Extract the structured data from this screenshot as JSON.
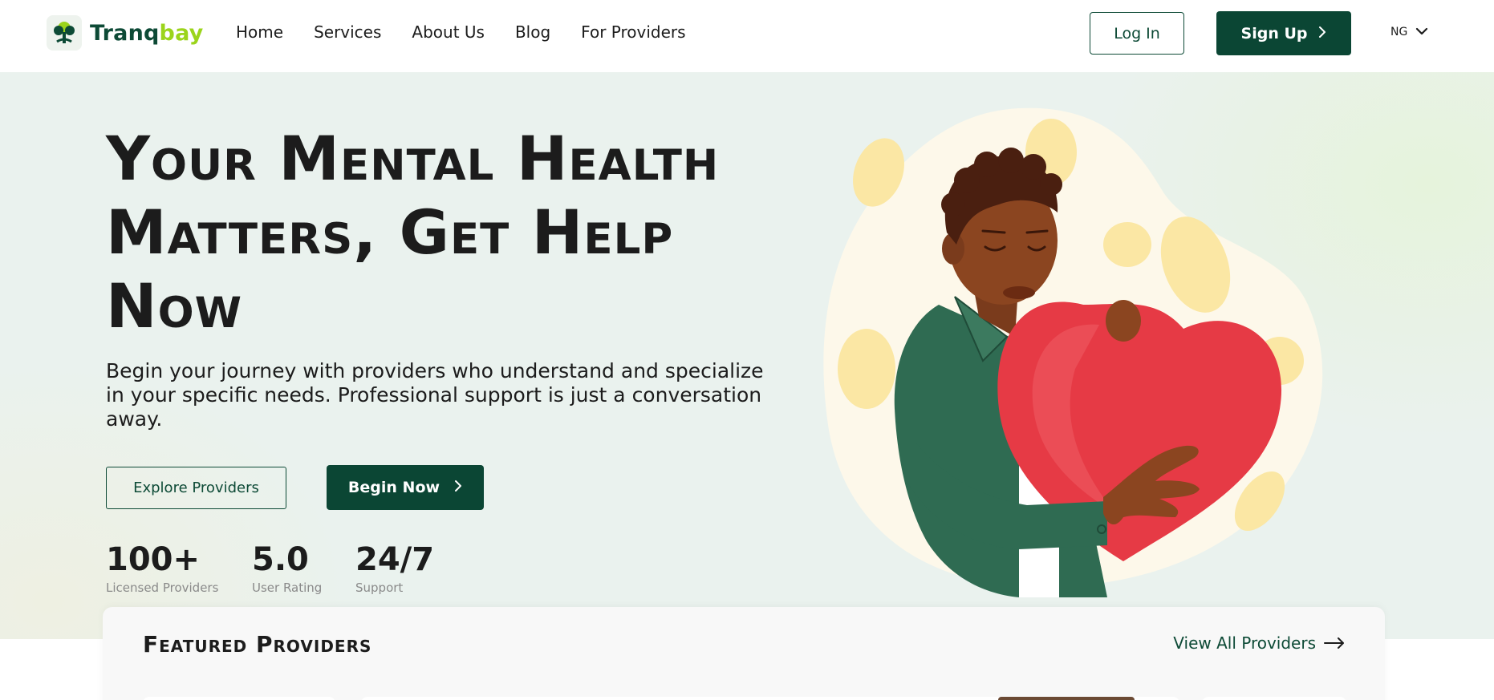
{
  "header": {
    "logo_part1": "Tranq",
    "logo_part2": "bay",
    "nav": [
      "Home",
      "Services",
      "About Us",
      "Blog",
      "For Providers"
    ],
    "login_label": "Log In",
    "signup_label": "Sign Up",
    "language": "NG"
  },
  "hero": {
    "title_line1": "Your Mental Health",
    "title_line2": "Matters, Get Help",
    "title_line3": "Now",
    "description": "Begin your journey with providers who understand and specialize in your specific needs. Professional support is just a conversation away.",
    "explore_label": "Explore Providers",
    "begin_label": "Begin Now",
    "stats": [
      {
        "value": "100+",
        "label": "Licensed Providers"
      },
      {
        "value": "5.0",
        "label": "User Rating"
      },
      {
        "value": "24/7",
        "label": "Support"
      }
    ]
  },
  "featured": {
    "title": "Featured Providers",
    "view_all_label": "View All Providers"
  },
  "colors": {
    "brand_dark": "#0b4634",
    "brand_lime": "#9bd41b",
    "hero_bg": "#eaf2ee",
    "heart_red": "#e63a45"
  }
}
